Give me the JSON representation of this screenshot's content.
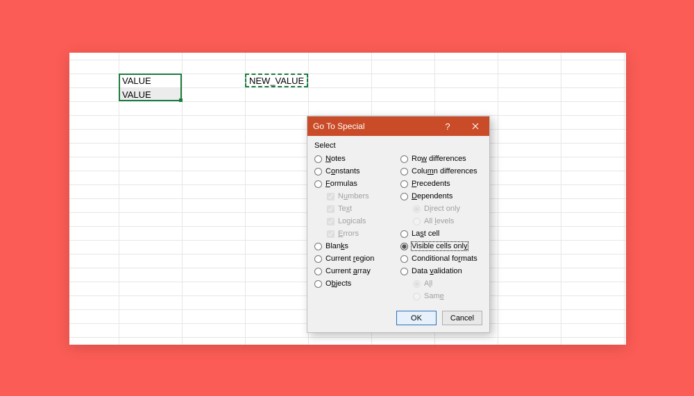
{
  "cells": {
    "a1": "VALUE",
    "a2": "VALUE",
    "c1": "NEW_VALUE"
  },
  "dialog": {
    "title": "Go To Special",
    "help": "?",
    "section": "Select",
    "left": {
      "notes": "Notes",
      "constants": "Constants",
      "formulas": "Formulas",
      "numbers": "Numbers",
      "text": "Text",
      "logicals": "Logicals",
      "errors": "Errors",
      "blanks": "Blanks",
      "current_region": "Current region",
      "current_array": "Current array",
      "objects": "Objects"
    },
    "right": {
      "row_diff": "Row differences",
      "col_diff": "Column differences",
      "precedents": "Precedents",
      "dependents": "Dependents",
      "direct_only": "Direct only",
      "all_levels": "All levels",
      "last_cell": "Last cell",
      "visible_cells": "Visible cells only",
      "conditional_formats": "Conditional formats",
      "data_validation": "Data validation",
      "all": "All",
      "same": "Same"
    },
    "buttons": {
      "ok": "OK",
      "cancel": "Cancel"
    }
  }
}
